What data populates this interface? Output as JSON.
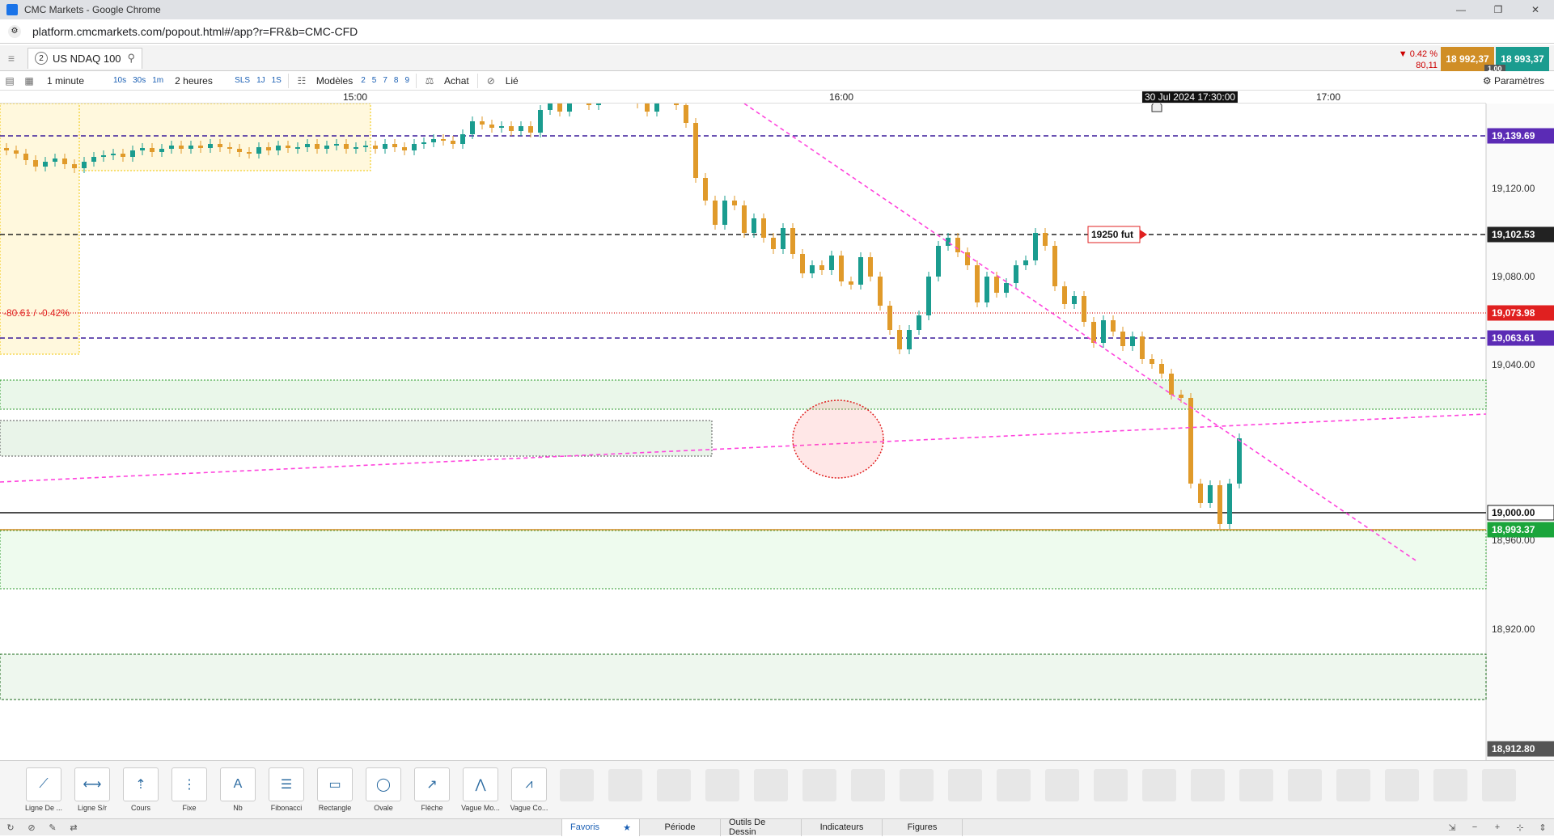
{
  "window": {
    "title": "CMC Markets - Google Chrome",
    "minimize": "—",
    "maximize": "❐",
    "close": "✕"
  },
  "browser": {
    "url": "platform.cmcmarkets.com/popout.html#/app?r=FR&b=CMC-CFD",
    "site_icon": "⚙"
  },
  "instrument": {
    "badge": "2",
    "name": "US NDAQ 100",
    "change_pct": "▼ 0.42 %",
    "change_pts": "80,11",
    "sell": "18 992,37",
    "buy": "18 993,37",
    "spread": "1.00"
  },
  "toolbar": {
    "interval": "1 minute",
    "quick": [
      "10s",
      "30s",
      "1m"
    ],
    "range": "2 heures",
    "range_quick": [
      "SLS",
      "1J",
      "1S"
    ],
    "models": "Modèles",
    "nums": [
      "2",
      "5",
      "7",
      "8",
      "9"
    ],
    "buy": "Achat",
    "linked": "Lié",
    "params": "Paramètres"
  },
  "time_axis": {
    "labels": [
      "15:00",
      "16:00",
      "17:00"
    ],
    "cursor": "30 Jul 2024 17:30:00"
  },
  "annotations": {
    "change_label": "-80.61 / -0.42%",
    "future_tag": "19250 fut"
  },
  "chart_data": {
    "type": "candlestick",
    "instrument": "US NDAQ 100",
    "interval": "1 minute",
    "y_ticks": [
      "19,120.00",
      "19,080.00",
      "19,040.00",
      "19,000.00",
      "18,960.00",
      "18,920.00"
    ],
    "price_tags": [
      {
        "label": "19,139.69",
        "color": "#5b2bb5"
      },
      {
        "label": "19,102.53",
        "color": "#222222"
      },
      {
        "label": "19,073.98",
        "color": "#e02020"
      },
      {
        "label": "19,063.61",
        "color": "#5b2bb5"
      },
      {
        "label": "19,000.00",
        "color": "#222222"
      },
      {
        "label": "18,993.37",
        "color": "#1aa53b"
      },
      {
        "label": "18,912.80",
        "color": "#555555"
      }
    ],
    "bull_color": "#1a9c8f",
    "bear_color": "#e09a2a"
  },
  "tools": [
    {
      "label": "Ligne De ...",
      "icon": "line-icon"
    },
    {
      "label": "Ligne S/r",
      "icon": "hline-icon"
    },
    {
      "label": "Cours",
      "icon": "price-icon"
    },
    {
      "label": "Fixe",
      "icon": "fixed-icon"
    },
    {
      "label": "Nb",
      "icon": "text-icon"
    },
    {
      "label": "Fibonacci",
      "icon": "fibonacci-icon"
    },
    {
      "label": "Rectangle",
      "icon": "rectangle-icon"
    },
    {
      "label": "Ovale",
      "icon": "oval-icon"
    },
    {
      "label": "Flèche",
      "icon": "arrow-icon"
    },
    {
      "label": "Vague Mo...",
      "icon": "wave-icon"
    },
    {
      "label": "Vague Co...",
      "icon": "wave2-icon"
    }
  ],
  "statusbar": {
    "tabs": [
      "Favoris",
      "Période",
      "Outils De Dessin",
      "Indicateurs",
      "Figures"
    ]
  }
}
